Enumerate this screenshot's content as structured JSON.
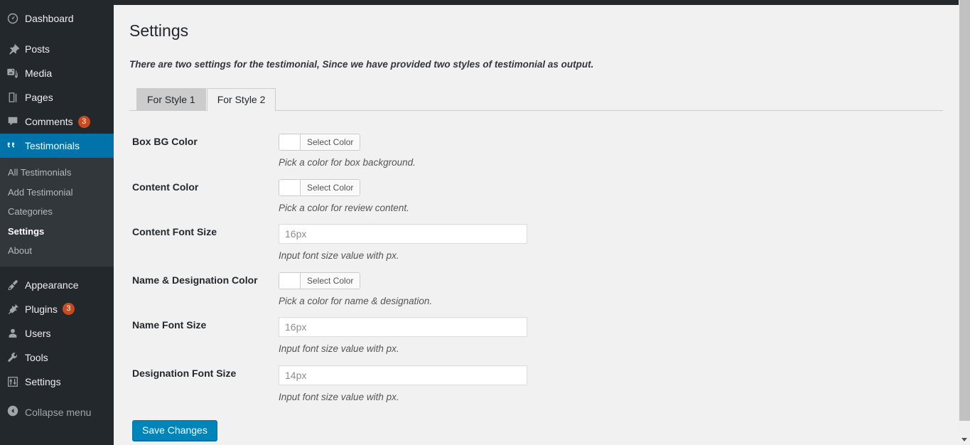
{
  "window": {
    "admin_bar_color": "#23282d",
    "accent_color": "#0073aa",
    "badge_color": "#ca4a1f",
    "button_color": "#0085ba"
  },
  "sidebar": {
    "items": [
      {
        "label": "Dashboard",
        "icon": "dashboard-icon",
        "badge": null,
        "current": false
      },
      {
        "label": "Posts",
        "icon": "pin-icon",
        "badge": null,
        "current": false
      },
      {
        "label": "Media",
        "icon": "media-icon",
        "badge": null,
        "current": false
      },
      {
        "label": "Pages",
        "icon": "pages-icon",
        "badge": null,
        "current": false
      },
      {
        "label": "Comments",
        "icon": "comment-icon",
        "badge": "3",
        "current": false
      },
      {
        "label": "Testimonials",
        "icon": "quote-icon",
        "badge": null,
        "current": true
      }
    ],
    "submenu": [
      {
        "label": "All Testimonials",
        "current": false
      },
      {
        "label": "Add Testimonial",
        "current": false
      },
      {
        "label": "Categories",
        "current": false
      },
      {
        "label": "Settings",
        "current": true
      },
      {
        "label": "About",
        "current": false
      }
    ],
    "items_lower": [
      {
        "label": "Appearance",
        "icon": "brush-icon",
        "badge": null,
        "current": false
      },
      {
        "label": "Plugins",
        "icon": "plugin-icon",
        "badge": "3",
        "current": false
      },
      {
        "label": "Users",
        "icon": "user-icon",
        "badge": null,
        "current": false
      },
      {
        "label": "Tools",
        "icon": "wrench-icon",
        "badge": null,
        "current": false
      },
      {
        "label": "Settings",
        "icon": "sliders-icon",
        "badge": null,
        "current": false
      }
    ],
    "collapse": {
      "label": "Collapse menu",
      "icon": "collapse-arrow-icon"
    }
  },
  "main": {
    "title": "Settings",
    "intro": "There are two settings for the testimonial, Since we have provided two styles of testimonial as output.",
    "tabs": [
      {
        "label": "For Style 1",
        "active": false
      },
      {
        "label": "For Style 2",
        "active": true
      }
    ],
    "fields": [
      {
        "label": "Box BG Color",
        "type": "color",
        "button_label": "Select Color",
        "swatch": "#ffffff",
        "description": "Pick a color for box background."
      },
      {
        "label": "Content Color",
        "type": "color",
        "button_label": "Select Color",
        "swatch": "#ffffff",
        "description": "Pick a color for review content."
      },
      {
        "label": "Content Font Size",
        "type": "text",
        "value": "",
        "placeholder": "16px",
        "description": "Input font size value with px."
      },
      {
        "label": "Name & Designation Color",
        "type": "color",
        "button_label": "Select Color",
        "swatch": "#ffffff",
        "description": "Pick a color for name & designation."
      },
      {
        "label": "Name Font Size",
        "type": "text",
        "value": "",
        "placeholder": "16px",
        "description": "Input font size value with px."
      },
      {
        "label": "Designation Font Size",
        "type": "text",
        "value": "",
        "placeholder": "14px",
        "description": "Input font size value with px."
      }
    ],
    "submit_label": "Save Changes"
  }
}
